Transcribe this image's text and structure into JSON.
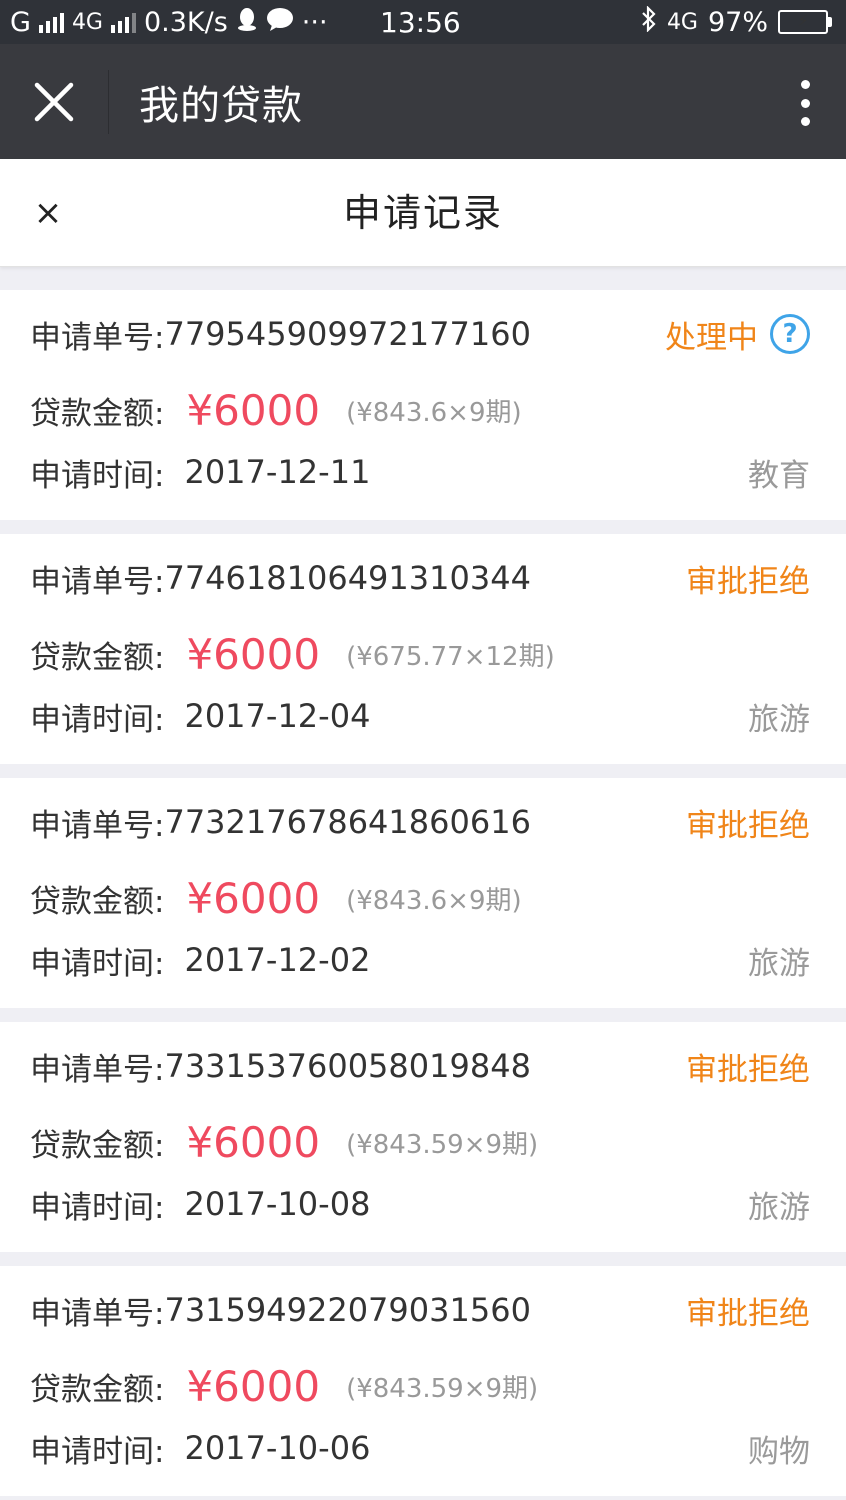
{
  "status_bar": {
    "carrier1": "G",
    "carrier2": "4G",
    "speed": "0.3K/s",
    "more": "···",
    "time": "13:56",
    "network": "4G",
    "battery": "97%",
    "battery_level": 0.97,
    "battery_color": "#4cd964"
  },
  "appbar": {
    "title": "我的贷款"
  },
  "page": {
    "title": "申请记录",
    "close_label": "×"
  },
  "labels": {
    "order_no": "申请单号: ",
    "amount": "贷款金额:",
    "apply_time": "申请时间:"
  },
  "help_icon": "?",
  "records": [
    {
      "order_no": "779545909972177160",
      "status": "处理中",
      "amount": "¥6000",
      "plan": "(¥843.6×9期)",
      "date": "2017-12-11",
      "purpose": "教育"
    },
    {
      "order_no": "774618106491310344",
      "status": "审批拒绝",
      "amount": "¥6000",
      "plan": "(¥675.77×12期)",
      "date": "2017-12-04",
      "purpose": "旅游"
    },
    {
      "order_no": "773217678641860616",
      "status": "审批拒绝",
      "amount": "¥6000",
      "plan": "(¥843.6×9期)",
      "date": "2017-12-02",
      "purpose": "旅游"
    },
    {
      "order_no": "733153760058019848",
      "status": "审批拒绝",
      "amount": "¥6000",
      "plan": "(¥843.59×9期)",
      "date": "2017-10-08",
      "purpose": "旅游"
    },
    {
      "order_no": "731594922079031560",
      "status": "审批拒绝",
      "amount": "¥6000",
      "plan": "(¥843.59×9期)",
      "date": "2017-10-06",
      "purpose": "购物"
    }
  ],
  "colors": {
    "amount": "#ef4a5f",
    "status": "#f08519",
    "help": "#3fa4e8",
    "header_bg": "#393a3f"
  }
}
